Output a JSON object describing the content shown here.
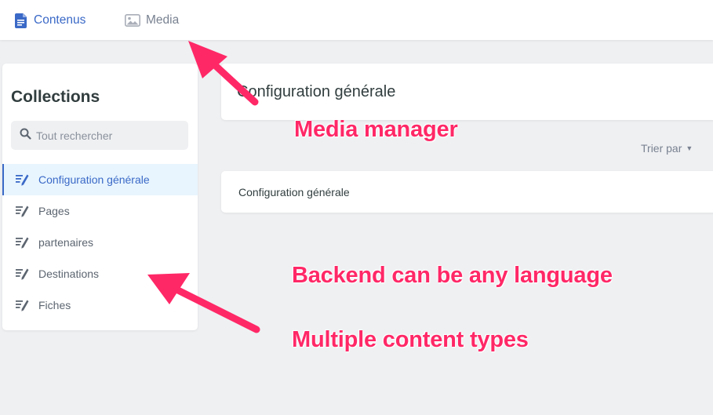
{
  "topnav": {
    "contents_label": "Contenus",
    "media_label": "Media"
  },
  "sidebar": {
    "title": "Collections",
    "search_placeholder": "Tout rechercher",
    "items": [
      {
        "label": "Configuration générale",
        "active": true
      },
      {
        "label": "Pages",
        "active": false
      },
      {
        "label": "partenaires",
        "active": false
      },
      {
        "label": "Destinations",
        "active": false
      },
      {
        "label": "Fiches",
        "active": false
      }
    ]
  },
  "main": {
    "title": "Configuration générale",
    "sort_label": "Trier par",
    "entries": [
      "Configuration générale"
    ]
  },
  "annotations": {
    "media_manager": "Media manager",
    "backend_language": "Backend can be any language",
    "multiple_types": "Multiple content types"
  },
  "colors": {
    "accent": "#3a69c7",
    "annotation": "#ff2867",
    "background": "#eff0f2"
  }
}
